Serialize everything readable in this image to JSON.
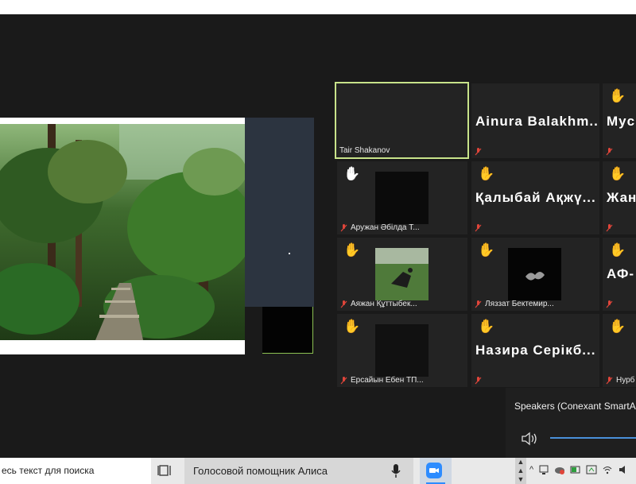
{
  "participants": [
    {
      "name": "Tair Shakanov",
      "active": true
    },
    {
      "display_name": "Ainura Balakhm...",
      "muted": true
    },
    {
      "display_name": "Myc",
      "muted": true,
      "hand_raised": true
    },
    {
      "name": "Аружан Әбілда Т...",
      "muted": true,
      "hand_raised": true,
      "hand_tone": "light"
    },
    {
      "display_name": "Қалыбай Ақжү...",
      "muted": true,
      "hand_raised": true
    },
    {
      "display_name": "Жан",
      "muted": true,
      "hand_raised": true
    },
    {
      "name": "Аяжан Құттыбек...",
      "muted": true,
      "hand_raised": true
    },
    {
      "name": "Ляззат Бектемир...",
      "muted": true,
      "hand_raised": true
    },
    {
      "display_name": "АФ-",
      "muted": true,
      "hand_raised": true
    },
    {
      "name": "Ерсайын Ебен ТП...",
      "muted": true,
      "hand_raised": true
    },
    {
      "display_name": "Назира Серікб...",
      "muted": true,
      "hand_raised": true
    },
    {
      "name": "Нурб",
      "muted": true,
      "hand_raised": true
    }
  ],
  "audio_popup": {
    "label": "Speakers (Conexant SmartA"
  },
  "taskbar": {
    "search_text": "есь текст для поиска",
    "alice_text": "Голосовой помощник Алиса"
  },
  "colors": {
    "active_border": "#c8e38a",
    "hand": "#f5c518",
    "muted_icon": "#e0453a",
    "zoom_blue": "#2d8cff"
  }
}
